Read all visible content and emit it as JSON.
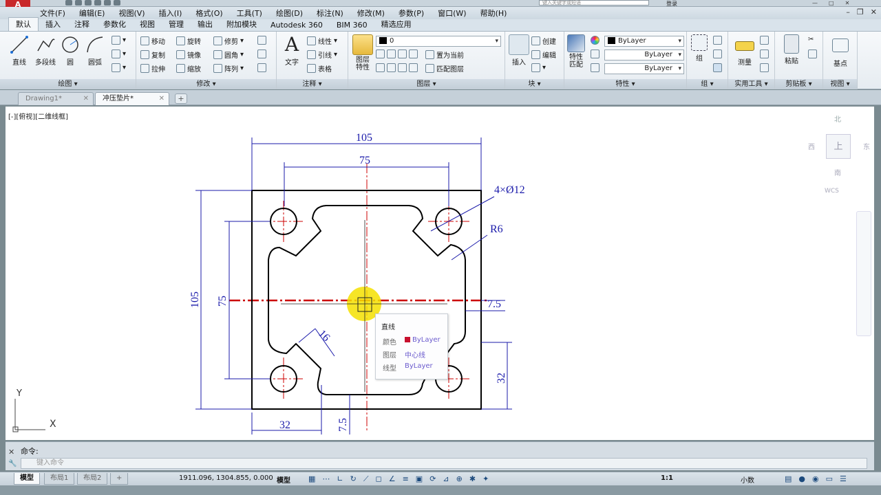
{
  "app": {
    "logo": "A",
    "search_placeholder": "键入关键字或短语",
    "signin": "登录"
  },
  "menu": [
    "文件(F)",
    "编辑(E)",
    "视图(V)",
    "插入(I)",
    "格式(O)",
    "工具(T)",
    "绘图(D)",
    "标注(N)",
    "修改(M)",
    "参数(P)",
    "窗口(W)",
    "帮助(H)"
  ],
  "ribbon_tabs": [
    "默认",
    "插入",
    "注释",
    "参数化",
    "视图",
    "管理",
    "输出",
    "附加模块",
    "Autodesk 360",
    "BIM 360",
    "精选应用"
  ],
  "ribbon": {
    "draw": {
      "line": "直线",
      "polyline": "多段线",
      "circle": "圆",
      "arc": "圆弧",
      "label": "绘图"
    },
    "modify": {
      "move": "移动",
      "rotate": "旋转",
      "trim": "修剪",
      "copy": "复制",
      "mirror": "镜像",
      "fillet": "圆角",
      "stretch": "拉伸",
      "scale": "缩放",
      "array": "阵列",
      "label": "修改"
    },
    "annotation": {
      "text": "文字",
      "linear": "线性",
      "leader": "引线",
      "table": "表格",
      "label": "注释"
    },
    "layers": {
      "layer_props": "图层特性",
      "current": "0",
      "make_current": "置为当前",
      "match_layer": "匹配图层",
      "label": "图层"
    },
    "block": {
      "insert": "插入",
      "create": "创建",
      "edit": "编辑",
      "label": "块"
    },
    "properties": {
      "match": "特性匹配",
      "color": "ByLayer",
      "linetype": "ByLayer",
      "lineweight": "ByLayer",
      "label": "特性"
    },
    "groups": {
      "group": "组",
      "label": "组"
    },
    "utilities": {
      "measure": "测量",
      "label": "实用工具"
    },
    "clipboard": {
      "paste": "粘贴",
      "label": "剪贴板"
    },
    "view": {
      "base": "基点",
      "label": "视图"
    }
  },
  "doc_tabs": [
    {
      "label": "Drawing1*"
    },
    {
      "label": "冲压垫片*"
    }
  ],
  "viewport_label": "[-][俯视][二维线框]",
  "viewcube": {
    "north": "北",
    "south": "南",
    "west": "西",
    "east": "东",
    "face": "上",
    "wcs": "WCS"
  },
  "ucs": {
    "x": "X",
    "y": "Y"
  },
  "drawing": {
    "dims": {
      "width_outer": "105",
      "width_inner": "75",
      "height_outer": "105",
      "height_inner": "75",
      "holes": "4×Ø12",
      "radius": "R6",
      "offset_right": "7.5",
      "bottom_left": "32",
      "bottom_offset": "7.5",
      "right_height": "32",
      "slot": "16"
    },
    "colors": {
      "outline": "#000000",
      "center": "#cc0000",
      "dim": "#1a1aaa",
      "highlight": "#f5e000"
    }
  },
  "tooltip": {
    "title": "直线",
    "rows": [
      {
        "key": "颜色",
        "value": "ByLayer"
      },
      {
        "key": "图层",
        "value": "中心线"
      },
      {
        "key": "线型",
        "value": "ByLayer"
      }
    ]
  },
  "command": {
    "history": "命令:",
    "placeholder": "键入命令"
  },
  "status": {
    "layouts": [
      "模型",
      "布局1",
      "布局2"
    ],
    "coords": "1911.096, 1304.855, 0.000",
    "model": "模型",
    "scale": "1:1",
    "annotation": "小数"
  }
}
